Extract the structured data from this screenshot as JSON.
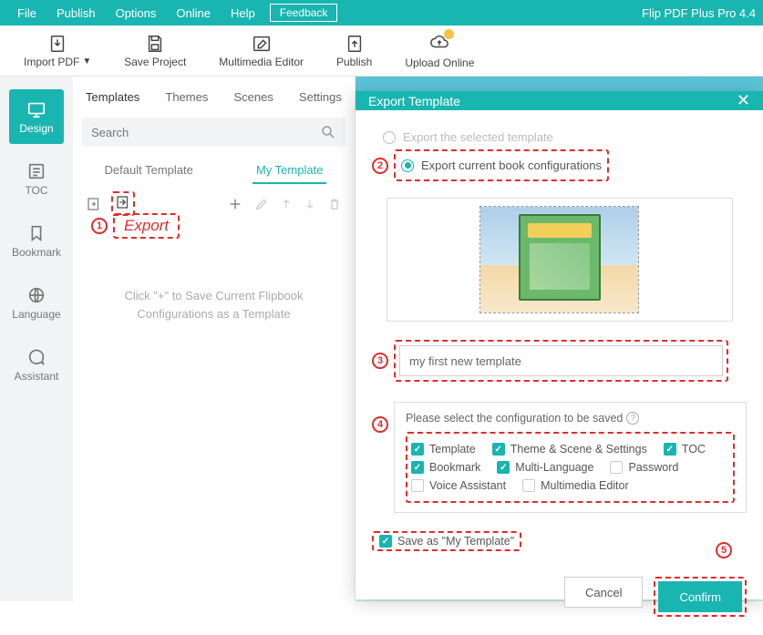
{
  "menu": {
    "file": "File",
    "publish": "Publish",
    "options": "Options",
    "online": "Online",
    "help": "Help",
    "feedback": "Feedback",
    "app": "Flip PDF Plus Pro 4.4"
  },
  "toolbar": {
    "import": "Import PDF",
    "save": "Save Project",
    "mm": "Multimedia Editor",
    "publish": "Publish",
    "upload": "Upload Online"
  },
  "left": {
    "design": "Design",
    "toc": "TOC",
    "bookmark": "Bookmark",
    "language": "Language",
    "assistant": "Assistant"
  },
  "panel": {
    "tabs": {
      "templates": "Templates",
      "themes": "Themes",
      "scenes": "Scenes",
      "settings": "Settings"
    },
    "search": "Search",
    "sub": {
      "default": "Default Template",
      "my": "My Template"
    },
    "empty": "Click \"+\" to Save Current Flipbook\nConfigurations as a Template"
  },
  "callouts": {
    "c1": "1",
    "c1label": "Export",
    "c2": "2",
    "c3": "3",
    "c4": "4",
    "c5": "5"
  },
  "modal": {
    "title": "Export Template",
    "r1": "Export the selected template",
    "r2": "Export current book configurations",
    "name": "my first new template",
    "cfgTitle": "Please select the configuration to be saved",
    "opts": {
      "template": "Template",
      "theme": "Theme & Scene & Settings",
      "toc": "TOC",
      "bookmark": "Bookmark",
      "multilang": "Multi-Language",
      "password": "Password",
      "voice": "Voice Assistant",
      "mm": "Multimedia Editor"
    },
    "save": "Save as \"My Template\"",
    "cancel": "Cancel",
    "confirm": "Confirm"
  }
}
